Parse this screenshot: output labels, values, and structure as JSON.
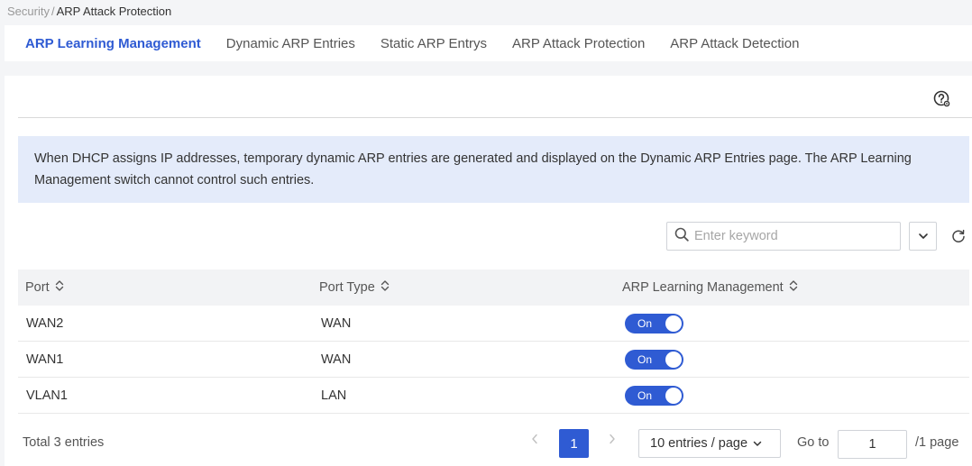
{
  "breadcrumb": {
    "parent": "Security",
    "separator": "/",
    "current": "ARP Attack Protection"
  },
  "tabs": [
    {
      "label": "ARP Learning Management",
      "active": true
    },
    {
      "label": "Dynamic ARP Entries",
      "active": false
    },
    {
      "label": "Static ARP Entrys",
      "active": false
    },
    {
      "label": "ARP Attack Protection",
      "active": false
    },
    {
      "label": "ARP Attack Detection",
      "active": false
    }
  ],
  "notice": "When DHCP assigns IP addresses, temporary dynamic ARP entries are generated and displayed on the Dynamic ARP Entries page. The ARP Learning Management switch cannot control such entries.",
  "search": {
    "placeholder": "Enter keyword",
    "value": ""
  },
  "table": {
    "columns": [
      "Port",
      "Port Type",
      "ARP Learning Management"
    ],
    "rows": [
      {
        "port": "WAN2",
        "type": "WAN",
        "state": "On"
      },
      {
        "port": "WAN1",
        "type": "WAN",
        "state": "On"
      },
      {
        "port": "VLAN1",
        "type": "LAN",
        "state": "On"
      }
    ]
  },
  "pagination": {
    "total": "Total 3 entries",
    "current_page": "1",
    "page_size": "10 entries / page",
    "goto_label": "Go to",
    "goto_value": "1",
    "page_total": "/1 page"
  },
  "icons": {
    "help": "help-icon",
    "search": "search-icon",
    "dropdown": "chevron-down-icon",
    "refresh": "refresh-icon",
    "sort": "sort-icon",
    "prev": "chevron-left-icon",
    "next": "chevron-right-icon"
  },
  "colors": {
    "accent": "#2f5bd3",
    "notice_bg": "#e4ebfa"
  }
}
